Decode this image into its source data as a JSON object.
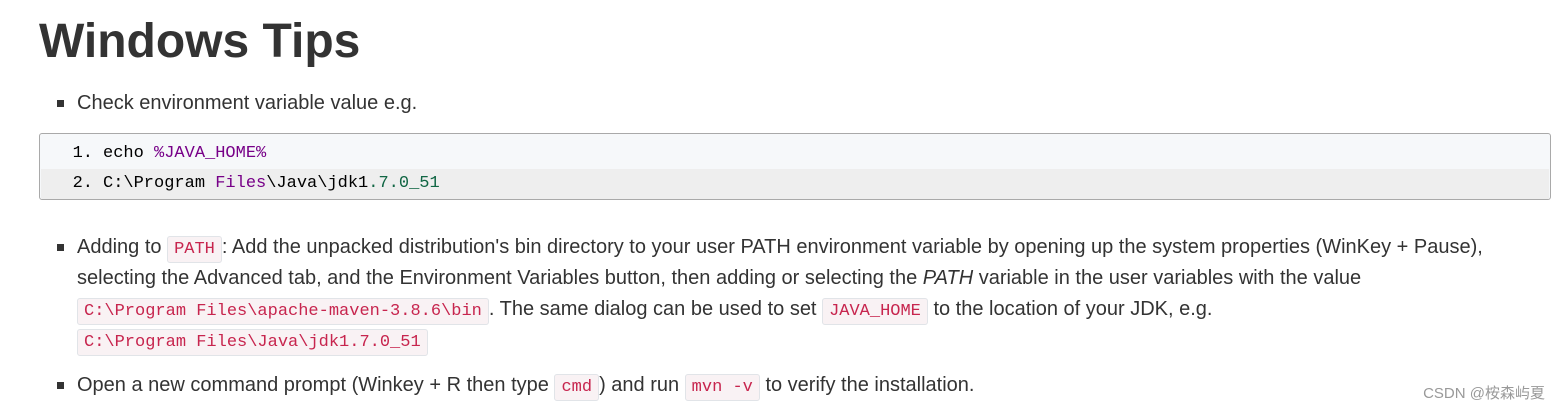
{
  "title": "Windows Tips",
  "bullet1": {
    "text": "Check environment variable value e.g."
  },
  "code": {
    "lines": [
      {
        "num": "1.",
        "p1": "echo ",
        "p2": "%JAVA_HOME%"
      },
      {
        "num": "2.",
        "p1": "C:\\Program ",
        "p2": "Files",
        "p3": "\\Java\\jdk1",
        "p4": ".7",
        "p5": ".0_51"
      }
    ]
  },
  "bullet2": {
    "t1": "Adding to ",
    "c1": "PATH",
    "t2": ": Add the unpacked distribution's bin directory to your user PATH environment variable by opening up the system properties (WinKey + Pause),",
    "t3": "selecting the Advanced tab, and the Environment Variables button, then adding or selecting the ",
    "em": "PATH",
    "t4": " variable in the user variables with the value",
    "c2": "C:\\Program Files\\apache-maven-3.8.6\\bin",
    "t5": ". The same dialog can be used to set ",
    "c3": "JAVA_HOME",
    "t6": " to the location of your JDK, e.g.",
    "c4": "C:\\Program Files\\Java\\jdk1.7.0_51"
  },
  "bullet3": {
    "t1": "Open a new command prompt (Winkey + R then type ",
    "c1": "cmd",
    "t2": ") and run ",
    "c2": "mvn -v",
    "t3": " to verify the installation."
  },
  "watermark": "CSDN @桉森屿夏"
}
